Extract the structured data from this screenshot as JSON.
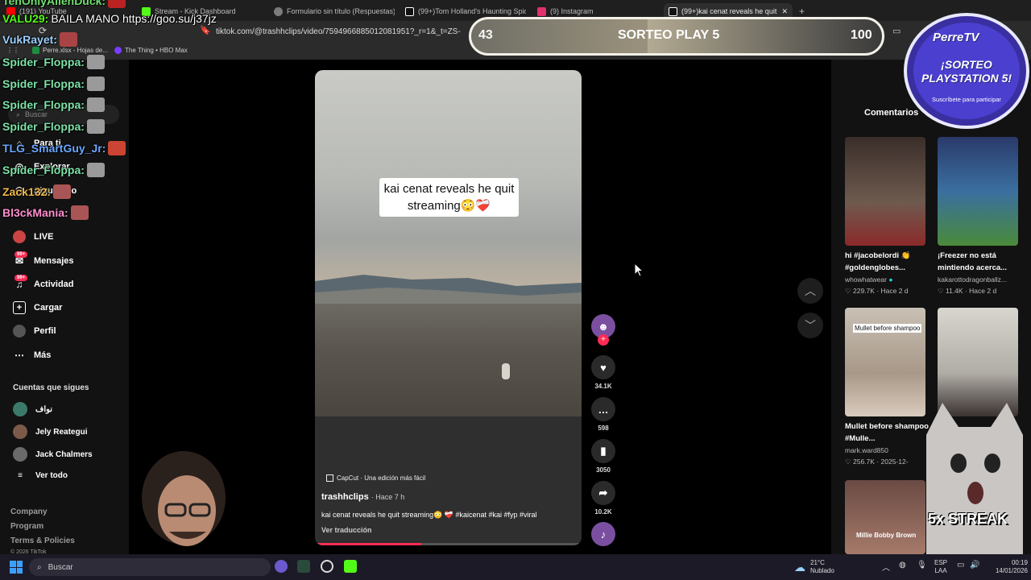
{
  "browser": {
    "tabs": [
      {
        "label": "(191) YouTube",
        "color": "#ff0000"
      },
      {
        "label": "Stream - Kick Dashboard",
        "color": "#53fc18"
      },
      {
        "label": "Formulario sin título (Respuestas)",
        "color": "#7c7c7c"
      },
      {
        "label": "(99+)Tom Holland's Haunting Spider",
        "color": "#ffffff"
      },
      {
        "label": "(9) Instagram",
        "color": "#e1306c"
      },
      {
        "label": "(99+)kai cenat reveals he quit",
        "color": "#ffffff"
      }
    ],
    "new_tab": "+",
    "url": "tiktok.com/@trashhclips/video/7594966885012081951?_r=1&_t=ZS-",
    "bookmarks": [
      {
        "label": "Perre.xlsx - Hojas de...",
        "color": "#1e8e3e"
      },
      {
        "label": "The Thing • HBO Max",
        "color": "#7a3cff"
      }
    ]
  },
  "sidebar": {
    "search_placeholder": "Buscar",
    "items": [
      {
        "label": "Para ti",
        "icon": "home-icon"
      },
      {
        "label": "Explorar",
        "icon": "compass-icon"
      },
      {
        "label": "Siguiendo",
        "icon": "users-icon"
      },
      {
        "label": "LIVE",
        "icon": "live-icon"
      },
      {
        "label": "Mensajes",
        "icon": "inbox-icon",
        "badge": "99+"
      },
      {
        "label": "Actividad",
        "icon": "bell-icon",
        "badge": "99+"
      },
      {
        "label": "Cargar",
        "icon": "upload-icon"
      },
      {
        "label": "Perfil",
        "icon": "profile-icon"
      },
      {
        "label": "Más",
        "icon": "more-icon"
      }
    ],
    "following_title": "Cuentas que sigues",
    "following": [
      {
        "name": "نواف",
        "color": "#3b7a6a"
      },
      {
        "name": "Jely Reategui",
        "color": "#7b5a4a"
      },
      {
        "name": "Jack Chalmers",
        "color": "#6a6a6a"
      }
    ],
    "see_all": "Ver todo",
    "footer": [
      "Company",
      "Program",
      "Terms & Policies",
      "© 2026 TikTok"
    ]
  },
  "chat": [
    {
      "user": "TehOnlyAllenDuck:",
      "msg": "",
      "color": "#6fe06f",
      "emote": "#b22"
    },
    {
      "user": "VALU29:",
      "msg": "BAILA MANO https://goo.su/j37jz",
      "color": "#53fc18",
      "emote": ""
    },
    {
      "user": "VukRayet:",
      "msg": "",
      "color": "#9ad0ff",
      "emote": "#a44"
    },
    {
      "user": "Spider_Floppa:",
      "msg": "",
      "color": "#7ee2a8",
      "emote": "#9a9a9a"
    },
    {
      "user": "Spider_Floppa:",
      "msg": "",
      "color": "#7ee2a8",
      "emote": "#9a9a9a"
    },
    {
      "user": "Spider_Floppa:",
      "msg": "",
      "color": "#7ee2a8",
      "emote": "#9a9a9a"
    },
    {
      "user": "Spider_Floppa:",
      "msg": "",
      "color": "#7ee2a8",
      "emote": "#9a9a9a"
    },
    {
      "user": "TLG_SmartGuy_Jr:",
      "msg": "",
      "color": "#6aa8ff",
      "emote": "#c43"
    },
    {
      "user": "Spider_Floppa:",
      "msg": "",
      "color": "#7ee2a8",
      "emote": "#9a9a9a"
    },
    {
      "user": "Zack132:",
      "msg": "",
      "color": "#f0b94a",
      "emote": "#a55"
    },
    {
      "user": "Bl3ckMania:",
      "msg": "",
      "color": "#ff8fcf",
      "emote": "#a55"
    }
  ],
  "video": {
    "caption": "kai cenat reveals he quit streaming😳❤️‍🩹",
    "capcut": "CapCut · Una edición más fácil",
    "author": "trashhclips",
    "time": "· Hace 7 h",
    "description": "kai cenat reveals he quit streaming😳 ❤️‍🩹 #kaicenat #kai #fyp #viral",
    "translate": "Ver traducción",
    "progress": 0.4
  },
  "actions": {
    "likes": "34.1K",
    "comments": "598",
    "saves": "3050",
    "shares": "10.2K"
  },
  "right_panel": {
    "tab_comments": "Comentarios",
    "videos": [
      {
        "title": "hi #jacobelordi 👏 #goldenglobes...",
        "author": "whowhatwear",
        "verified": true,
        "likes": "229.7K",
        "date": "Hace 2 d",
        "color": "#6e5a4e"
      },
      {
        "title": "¡Freezer no está mintiendo acerca...",
        "author": "kakarottodragonballz...",
        "verified": false,
        "likes": "11.4K",
        "date": "Hace 2 d",
        "color": "#3a6fa0"
      },
      {
        "title": "Mullet before shampoo #Mulle...",
        "author": "mark.ward850",
        "verified": false,
        "likes": "256.7K",
        "date": "2025-12-",
        "color": "#d9cbbd",
        "overlay": "Mullet before shampoo"
      },
      {
        "title": "",
        "author": "",
        "verified": false,
        "likes": "",
        "date": "",
        "color": "#c8c6c2"
      },
      {
        "title": "",
        "author": "",
        "verified": false,
        "likes": "",
        "date": "",
        "color": "#a67a6a",
        "overlay": "Millie Bobby Brown"
      }
    ]
  },
  "sorteo": {
    "left_value": "43",
    "title": "SORTEO PLAY 5",
    "right_value": "100",
    "progress": 0.43
  },
  "perretv": {
    "name": "PerreTV",
    "line1": "¡SORTEO",
    "line2": "PLAYSTATION 5!",
    "sub": "Suscríbete para participar"
  },
  "streak": "5x STREAK",
  "taskbar": {
    "search": "Buscar",
    "weather_temp": "21°C",
    "weather_desc": "Nublado",
    "lang1": "ESP",
    "lang2": "LAA",
    "time": "00:19",
    "date": "14/01/2026"
  }
}
